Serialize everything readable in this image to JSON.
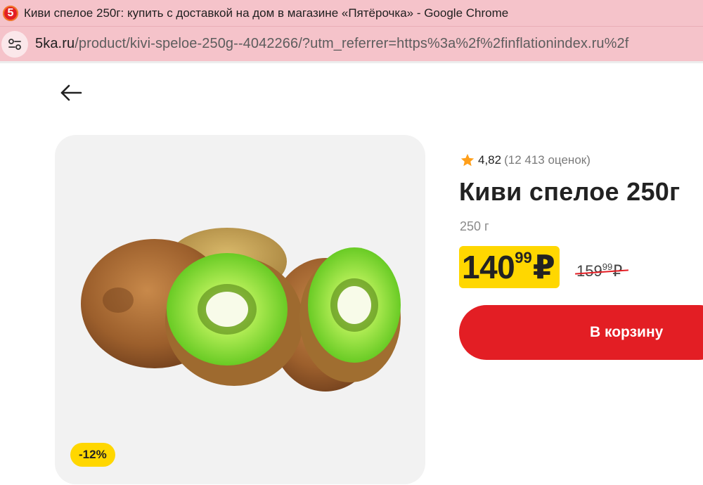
{
  "browser": {
    "favicon_glyph": "5",
    "window_title": "Киви спелое 250г: купить с доставкой на дом в магазине «Пятёрочка» - Google Chrome",
    "url_domain": "5ka.ru",
    "url_path": "/product/kivi-speloe-250g--4042266/?utm_referrer=https%3a%2f%2finflationindex.ru%2f"
  },
  "product": {
    "rating_score": "4,82",
    "rating_count": "(12 413 оценок)",
    "title": "Киви спелое 250г",
    "weight": "250 г",
    "price_rub": "140",
    "price_kop": "99",
    "currency": "₽",
    "old_price_rub": "159",
    "old_price_kop": "99",
    "discount": "-12%",
    "cart_label": "В корзину"
  },
  "icons": {
    "back": "arrow-left-icon",
    "site_info": "tune-icon",
    "star": "star-icon",
    "favicon": "pyaterochka-logo"
  },
  "colors": {
    "brand_red": "#e31e24",
    "price_yellow": "#ffd700",
    "chrome_pink": "#f5c3ca",
    "card_gray": "#f2f2f2"
  }
}
